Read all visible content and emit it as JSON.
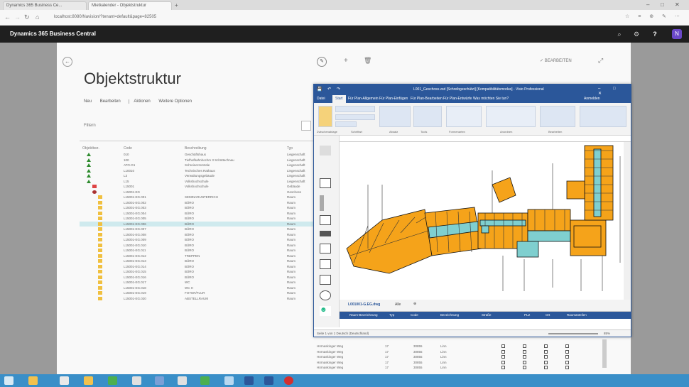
{
  "browser": {
    "tabs": [
      {
        "label": "Dynamics 365 Business Ce..."
      },
      {
        "label": "Mietkalender - Objektstruktur"
      }
    ],
    "url": "localhost:8080/Navision/?tenant=default&page=82505"
  },
  "app": {
    "name": "Dynamics 365 Business Central",
    "avatar_initial": "N"
  },
  "page": {
    "title": "Objektstruktur",
    "tabs": [
      "Neu",
      "Bearbeiten",
      "Aktionen",
      "Weitere Optionen"
    ],
    "filter_label": "Filtern",
    "action_right": "BEARBEITEN",
    "columns": [
      "Objektbez.",
      "Code",
      "Beschreibung",
      "Typ"
    ],
    "rows": [
      {
        "indent": 0,
        "icon": "tree",
        "code": "010",
        "desc": "Geschäftshaus",
        "type": "Liegenschaft"
      },
      {
        "indent": 0,
        "icon": "tree",
        "code": "100",
        "desc": "Tiefhofbahnhochm 3 Schüttechnau",
        "type": "Liegenschaft"
      },
      {
        "indent": 0,
        "icon": "tree",
        "code": "ATO-G1",
        "desc": "Schreinerzentrale",
        "type": "Liegenschaft"
      },
      {
        "indent": 0,
        "icon": "tree",
        "code": "L10010",
        "desc": "Technisches Rathaus",
        "type": "Liegenschaft"
      },
      {
        "indent": 0,
        "icon": "tree",
        "code": "L3",
        "desc": "Verwaltungsgebäude",
        "type": "Liegenschaft"
      },
      {
        "indent": 0,
        "icon": "tree",
        "code": "L15",
        "desc": "Volkshochschule",
        "type": "Liegenschaft"
      },
      {
        "indent": 1,
        "icon": "building",
        "code": "L15001",
        "desc": "Volkshochschule",
        "type": "Gebäude"
      },
      {
        "indent": 1,
        "icon": "floor",
        "code": "L15001-EG",
        "desc": "",
        "type": "Geschoss"
      },
      {
        "indent": 2,
        "icon": "room",
        "code": "L15001-EG.001",
        "desc": "SEMINARUNTERRICH",
        "type": "Raum"
      },
      {
        "indent": 2,
        "icon": "room",
        "code": "L15001-EG.002",
        "desc": "BÜRO",
        "type": "Raum"
      },
      {
        "indent": 2,
        "icon": "room",
        "code": "L15001-EG.003",
        "desc": "BÜRO",
        "type": "Raum"
      },
      {
        "indent": 2,
        "icon": "room",
        "code": "L15001-EG.004",
        "desc": "BÜRO",
        "type": "Raum"
      },
      {
        "indent": 2,
        "icon": "room",
        "code": "L15001-EG.005",
        "desc": "BÜRO",
        "type": "Raum"
      },
      {
        "indent": 2,
        "icon": "room",
        "code": "L15001-EG.006",
        "desc": "BÜRO",
        "type": "Raum",
        "selected": true
      },
      {
        "indent": 2,
        "icon": "room",
        "code": "L15001-EG.007",
        "desc": "BÜRO",
        "type": "Raum"
      },
      {
        "indent": 2,
        "icon": "room",
        "code": "L15001-EG.008",
        "desc": "BÜRO",
        "type": "Raum"
      },
      {
        "indent": 2,
        "icon": "room",
        "code": "L15001-EG.009",
        "desc": "BÜRO",
        "type": "Raum"
      },
      {
        "indent": 2,
        "icon": "room",
        "code": "L15001-EG.010",
        "desc": "BÜRO",
        "type": "Raum"
      },
      {
        "indent": 2,
        "icon": "room",
        "code": "L15001-EG.011",
        "desc": "BÜRO",
        "type": "Raum"
      },
      {
        "indent": 2,
        "icon": "room",
        "code": "L15001-EG.012",
        "desc": "TREPPEN",
        "type": "Raum"
      },
      {
        "indent": 2,
        "icon": "room",
        "code": "L15001-EG.013",
        "desc": "BÜRO",
        "type": "Raum"
      },
      {
        "indent": 2,
        "icon": "room",
        "code": "L15001-EG.014",
        "desc": "BÜRO",
        "type": "Raum"
      },
      {
        "indent": 2,
        "icon": "room",
        "code": "L15001-EG.015",
        "desc": "BÜRO",
        "type": "Raum"
      },
      {
        "indent": 2,
        "icon": "room",
        "code": "L15001-EG.016",
        "desc": "BÜRO",
        "type": "Raum"
      },
      {
        "indent": 2,
        "icon": "room",
        "code": "L15001-EG.017",
        "desc": "WC",
        "type": "Raum"
      },
      {
        "indent": 2,
        "icon": "room",
        "code": "L15001-EG.018",
        "desc": "WC H",
        "type": "Raum"
      },
      {
        "indent": 2,
        "icon": "room",
        "code": "L15001-EG.019",
        "desc": "FOYER/FLUR",
        "type": "Raum"
      },
      {
        "indent": 2,
        "icon": "room",
        "code": "L15001-EG.020",
        "desc": "ABSTELLRAUM",
        "type": "Raum"
      }
    ],
    "extra_cols": [
      {
        "street": "Hörnaskinger Weg",
        "no": "17",
        "zip": "30855",
        "city": "Linn"
      },
      {
        "street": "Hörnaskinger Weg",
        "no": "17",
        "zip": "30855",
        "city": "Linn"
      },
      {
        "street": "Hörnaskinger Weg",
        "no": "17",
        "zip": "30855",
        "city": "Linn"
      },
      {
        "street": "Hörnaskinger Weg",
        "no": "17",
        "zip": "30855",
        "city": "Linn"
      },
      {
        "street": "Hörnaskinger Weg",
        "no": "17",
        "zip": "30855",
        "city": "Linn"
      }
    ]
  },
  "word": {
    "title": "L001_Geschoss.vsd [Schreibgeschützt] [Kompatibilitätsmodus] - Visio Professional",
    "menu": [
      "Datei",
      "Start",
      "Für Plan-Allgemein",
      "Für Plan-Einfügen",
      "Für Plan-Bearbeiten",
      "Für Plan-Entwürfe",
      "Was möchten Sie tun?",
      "Anmelden"
    ],
    "active_menu": "Start",
    "ribbon_groups": [
      "Zwischenablage",
      "Schriftart",
      "Absatz",
      "Tools",
      "Formenarten",
      "Anordnen",
      "Bearbeiten"
    ],
    "sheet_tab": "L001001-G.EG.dwg",
    "sheet_all": "Alle",
    "shapedata_headers": [
      "Raum-Bezeichnung",
      "Typ",
      "Code",
      "Bezeichnung",
      "Straße",
      "PLZ",
      "Ort",
      "Raumanteilen"
    ],
    "status": "Seite 1 von 1    Deutsch (Deutschland)",
    "zoom": "85%"
  },
  "colors": {
    "appbar": "#1f1f1f",
    "visio_blue": "#2b579a",
    "floorplan_orange": "#f5a31a",
    "floorplan_teal": "#7fcfcf",
    "selected_row": "#cfeaee",
    "avatar": "#6b48c8"
  }
}
